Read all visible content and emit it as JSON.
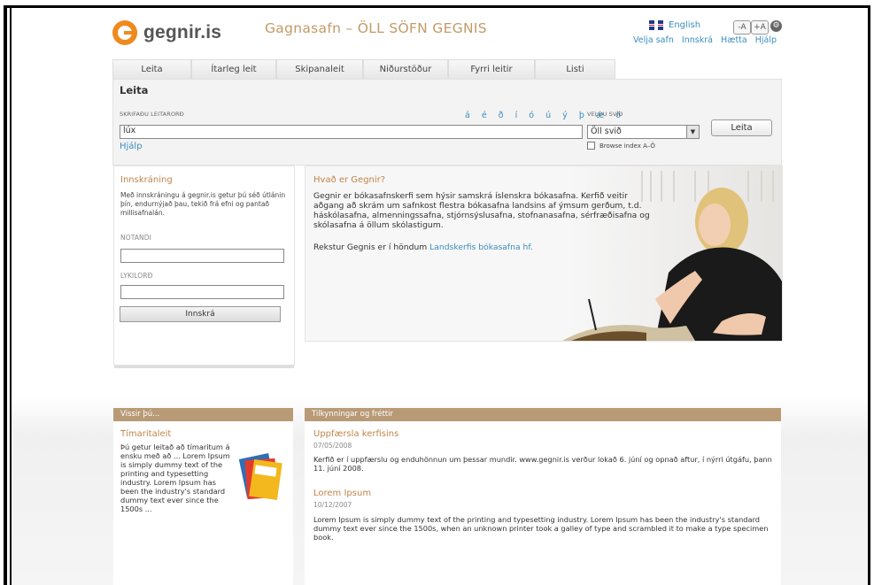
{
  "header": {
    "logo_text": "gegnir.is",
    "tagline": "Gagnasafn – ÖLL SÖFN GEGNIS",
    "language_link": "English",
    "font_decrease": "-A",
    "font_increase": "+A",
    "top_links": [
      "Velja safn",
      "Innskrá",
      "Hætta",
      "Hjálp"
    ]
  },
  "tabs": [
    "Leita",
    "Ítarleg leit",
    "Skipanaleit",
    "Niðurstöður",
    "Fyrri leitir",
    "Listi"
  ],
  "search": {
    "heading": "Leita",
    "input_label": "SKRIFAÐU LEITARORÐ",
    "special_chars": [
      "á",
      "é",
      "ð",
      "í",
      "ó",
      "ú",
      "ý",
      "þ",
      "æ",
      "ö"
    ],
    "value": "lúx",
    "scope_label": "VELDU SVIÐ",
    "scope_value": "Öll svið",
    "button": "Leita",
    "help_link": "Hjálp",
    "browse_label": "Browse index A–Ö"
  },
  "login": {
    "heading": "Innskráning",
    "intro": "Með innskráningu á gegnir.is getur þú séð útlánin þín, endurnýjað þau, tekið frá efni og pantað millisafnalán.",
    "user_label": "NOTANDI",
    "password_label": "LYKILORÐ",
    "button": "Innskrá"
  },
  "about": {
    "heading": "Hvað er Gegnir?",
    "text": "Gegnir er bókasafnskerfi sem hýsir samskrá íslenskra bókasafna. Kerfið veitir aðgang að skrám um safnkost flestra bókasafna landsins af ýmsum gerðum, t.d. háskólasafna, almenningssafna, stjórnsýslusafna, stofnanasafna, sérfræðisafna og skólasafna á öllum skólastigum.",
    "operator_prefix": "Rekstur Gegnis er í höndum ",
    "operator_link": "Landskerfis bókasafna hf."
  },
  "did_you_know": {
    "bar_title": "Vissir þú...",
    "heading": "Tímaritaleit",
    "text": "Þú getur leitað að tímaritum á ensku með að ... Lorem Ipsum is simply dummy text of the printing and typesetting industry. Lorem Ipsum has been the industry's standard dummy text ever since the 1500s ..."
  },
  "news": {
    "bar_title": "Tilkynningar og fréttir",
    "items": [
      {
        "title": "Uppfærsla kerfisins",
        "date": "07/05/2008",
        "text": "Kerfið er í uppfærslu og enduhönnun um þessar mundir. www.gegnir.is verður lokað 6. júní og opnað aftur, í nýrri útgáfu, þann 11. júní 2008."
      },
      {
        "title": "Lorem Ipsum",
        "date": "10/12/2007",
        "text": "Lorem Ipsum is simply dummy text of the printing and typesetting industry. Lorem Ipsum has been the industry's standard dummy text ever since the 1500s, when an unknown printer took a galley of type and scrambled it to make a type specimen book."
      }
    ]
  },
  "colors": {
    "accent_orange": "#ef8a1d",
    "link_blue": "#3a8dbf",
    "bar_brown": "#b89a76",
    "heading_orange": "#c0854a"
  }
}
